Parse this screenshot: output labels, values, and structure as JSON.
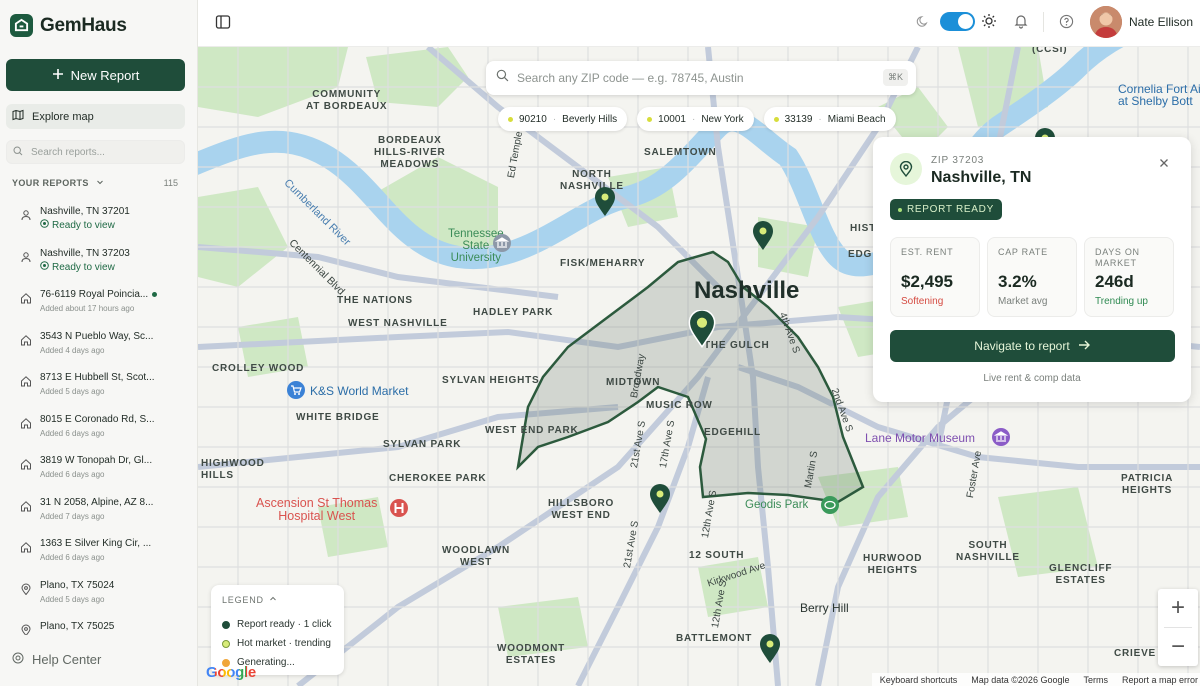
{
  "brand": {
    "name": "GemHaus"
  },
  "sidebar": {
    "new_report": "New Report",
    "explore_map": "Explore map",
    "search_placeholder": "Search reports...",
    "your_reports": "YOUR REPORTS",
    "report_count": "115",
    "help": "Help Center",
    "reports": [
      {
        "title": "Nashville, TN 37201",
        "sub": "Ready to view",
        "icon": "person-icon",
        "ready": true
      },
      {
        "title": "Nashville, TN 37203",
        "sub": "Ready to view",
        "icon": "person-icon",
        "ready": true
      },
      {
        "title": "76-6119 Royal Poincia...",
        "sub": "Added about 17 hours ago",
        "icon": "home-icon",
        "unread": true
      },
      {
        "title": "3543 N Pueblo Way, Sc...",
        "sub": "Added 4 days ago",
        "icon": "home-icon"
      },
      {
        "title": "8713 E Hubbell St, Scot...",
        "sub": "Added 5 days ago",
        "icon": "home-icon"
      },
      {
        "title": "8015 E Coronado Rd, S...",
        "sub": "Added 6 days ago",
        "icon": "home-icon"
      },
      {
        "title": "3819 W Tonopah Dr, Gl...",
        "sub": "Added 6 days ago",
        "icon": "home-icon"
      },
      {
        "title": "31 N 2058, Alpine, AZ 8...",
        "sub": "Added 7 days ago",
        "icon": "home-icon"
      },
      {
        "title": "1363 E Silver King Cir, ...",
        "sub": "Added 6 days ago",
        "icon": "home-icon"
      },
      {
        "title": "Plano, TX 75024",
        "sub": "Added 5 days ago",
        "icon": "location-pin-icon"
      },
      {
        "title": "Plano, TX 75025",
        "sub": "",
        "icon": "location-pin-icon"
      }
    ]
  },
  "topbar": {
    "user_name": "Nate Ellison"
  },
  "map": {
    "search_placeholder": "Search any ZIP code — e.g. 78745, Austin",
    "search_shortcut": "⌘K",
    "chips": [
      {
        "zip": "90210",
        "city": "Beverly Hills"
      },
      {
        "zip": "10001",
        "city": "New York"
      },
      {
        "zip": "33139",
        "city": "Miami Beach"
      }
    ],
    "labels": {
      "community": "COMMUNITY\nAT BORDEAUX",
      "bordeaux_hills": "BORDEAUX\nHILLS-RIVER\nMEADOWS",
      "salemtown": "SALEMTOWN",
      "north_nashville": "NORTH\nNASHVILLE",
      "tn_state": "Tennessee\nState\nUniversity",
      "fisk": "FISK/MEHARRY",
      "the_nations": "THE NATIONS",
      "west_nashville": "WEST NASHVILLE",
      "hadley_park": "HADLEY PARK",
      "nashville": "Nashville",
      "the_gulch": "THE GULCH",
      "crolley": "CROLLEY WOOD",
      "sylvan_heights": "SYLVAN HEIGHTS",
      "midtown": "MIDTOWN",
      "white_bridge": "WHITE BRIDGE",
      "ks_market": "K&S World Market",
      "music_row": "MUSIC ROW",
      "west_end_park": "WEST END PARK",
      "edgehill": "EDGEHILL",
      "sylvan_park": "SYLVAN PARK",
      "highwood": "HIGHWOOD\nHILLS",
      "cherokee": "CHEROKEE PARK",
      "ascension": "Ascension St Thomas\nHospital West",
      "hillsboro": "HILLSBORO\nWEST END",
      "geodis": "Geodis Park",
      "lane_motor": "Lane Motor Museum",
      "woodlawn": "WOODLAWN\nWEST",
      "twelve_south": "12 SOUTH",
      "hurwood": "HURWOOD\nHEIGHTS",
      "south_nashville": "SOUTH\nNASHVILLE",
      "glencliff": "GLENCLIFF\nESTATES",
      "patricia": "PATRICIA\nHEIGHTS",
      "berry_hill": "Berry Hill",
      "battlemont": "BATTLEMONT",
      "woodmont": "WOODMONT\nESTATES",
      "crieve": "CRIEVE",
      "ccsi": "(CCSI)",
      "cornelia": "Cornelia Fort Ai\nat Shelby Bott",
      "hist": "HIST",
      "edg": "EDG",
      "cumberland": "Cumberland River",
      "centennial": "Centennial Blvd",
      "ed_temple": "Ed Temple Blvd",
      "broadway": "Broadway",
      "ave_21": "21st Ave S",
      "ave_17": "17th Ave S",
      "ave_12": "12th Ave S",
      "ave_4th": "4th Ave S",
      "ave_2nd": "2nd Ave S",
      "martin": "Martin S",
      "foster": "Foster Ave",
      "kirkwood": "Kirkwood Ave",
      "ave_21b": "21st Ave S",
      "ave_12b": "12th Ave S"
    },
    "card": {
      "zip": "ZIP 37203",
      "city": "Nashville, TN",
      "status": "REPORT READY",
      "stats": [
        {
          "label": "EST. RENT",
          "value": "$2,495",
          "note": "Softening",
          "trend": "down"
        },
        {
          "label": "CAP RATE",
          "value": "3.2%",
          "note": "Market avg",
          "trend": "flat"
        },
        {
          "label": "DAYS ON\nMARKET",
          "value": "246d",
          "note": "Trending up",
          "trend": "up"
        }
      ],
      "cta": "Navigate to report",
      "footer": "Live rent & comp data"
    },
    "legend": {
      "title": "LEGEND",
      "items": [
        {
          "label": "Report ready · 1 click",
          "color": "#1f4d3a"
        },
        {
          "label": "Hot market · trending",
          "color": "#d8ec7a"
        },
        {
          "label": "Generating...",
          "color": "#f0a63a"
        }
      ]
    },
    "google": "Google",
    "attribution": [
      "Keyboard shortcuts",
      "Map data ©2026 Google",
      "Terms",
      "Report a map error"
    ],
    "zoom_in": "+",
    "zoom_out": "−"
  },
  "colors": {
    "brand_green": "#1f4d3a",
    "accent_lime": "#d8ec7a",
    "toggle_blue": "#1b8fd8"
  }
}
